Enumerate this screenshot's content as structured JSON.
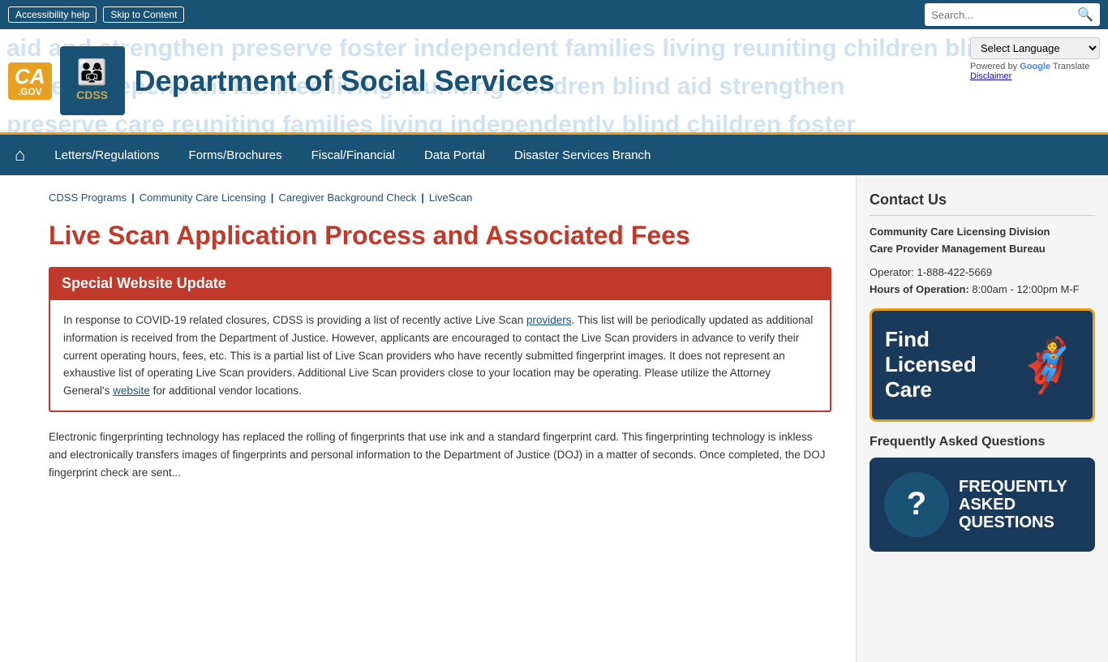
{
  "top_bar": {
    "accessibility_link": "Accessibility help",
    "skip_link": "Skip to Content"
  },
  "search": {
    "placeholder": "Search...",
    "button_icon": "🔍"
  },
  "header": {
    "ca_gov_label": "CA",
    "ca_gov_sub": ".GOV",
    "cdss_label": "CDSS",
    "title": "Department of Social Services",
    "bg_words": "aid and strengthen preserve foster independent families living reuniting children blind"
  },
  "language": {
    "label": "Select Language",
    "powered_by": "Powered by",
    "translate": "Google",
    "translate_label": "Translate",
    "disclaimer": "Disclaimer"
  },
  "nav": {
    "home_icon": "⌂",
    "items": [
      {
        "label": "Letters/Regulations",
        "href": "#"
      },
      {
        "label": "Forms/Brochures",
        "href": "#"
      },
      {
        "label": "Fiscal/Financial",
        "href": "#"
      },
      {
        "label": "Data Portal",
        "href": "#"
      },
      {
        "label": "Disaster Services Branch",
        "href": "#"
      }
    ]
  },
  "breadcrumb": {
    "items": [
      {
        "label": "CDSS Programs",
        "href": "#"
      },
      {
        "label": "Community Care Licensing",
        "href": "#"
      },
      {
        "label": "Caregiver Background Check",
        "href": "#"
      },
      {
        "label": "LiveScan",
        "href": "#"
      }
    ]
  },
  "page": {
    "title": "Live Scan Application Process and Associated Fees",
    "special_update_title": "Special Website Update",
    "special_update_body_1": "In response to COVID-19 related closures, CDSS is providing a list of recently active Live Scan ",
    "providers_link_text": "providers",
    "special_update_body_2": ". This list will be periodically updated as additional information is received from the Department of Justice. However, applicants are encouraged to contact the Live Scan providers in advance to verify their current operating hours, fees, etc. This is a partial list of Live Scan providers who have recently submitted fingerprint images. It does not represent an exhaustive list of operating Live Scan providers. Additional Live Scan providers close to your location may be operating. Please utilize the Attorney General's ",
    "website_link_text": "website",
    "special_update_body_3": " for additional vendor locations.",
    "body_text": "Electronic fingerprinting technology has replaced the rolling of fingerprints that use ink and a standard fingerprint card. This fingerprinting technology is inkless and electronically transfers images of fingerprints and personal information to the Department of Justice (DOJ) in a matter of seconds. Once completed, the DOJ fingerprint check are sent..."
  },
  "sidebar": {
    "contact_title": "Contact Us",
    "org_line1": "Community Care Licensing Division",
    "org_line2": "Care Provider Management Bureau",
    "operator_label": "Operator:",
    "operator_phone": "1-888-422-5669",
    "hours_label": "Hours of Operation:",
    "hours_value": "8:00am - 12:00pm M-F",
    "find_care_text": "Find Licensed Care",
    "find_care_mascot": "🦸",
    "faq_title": "Frequently Asked Questions",
    "faq_text": "FREQUENTLY ASKED QUESTIONS"
  }
}
